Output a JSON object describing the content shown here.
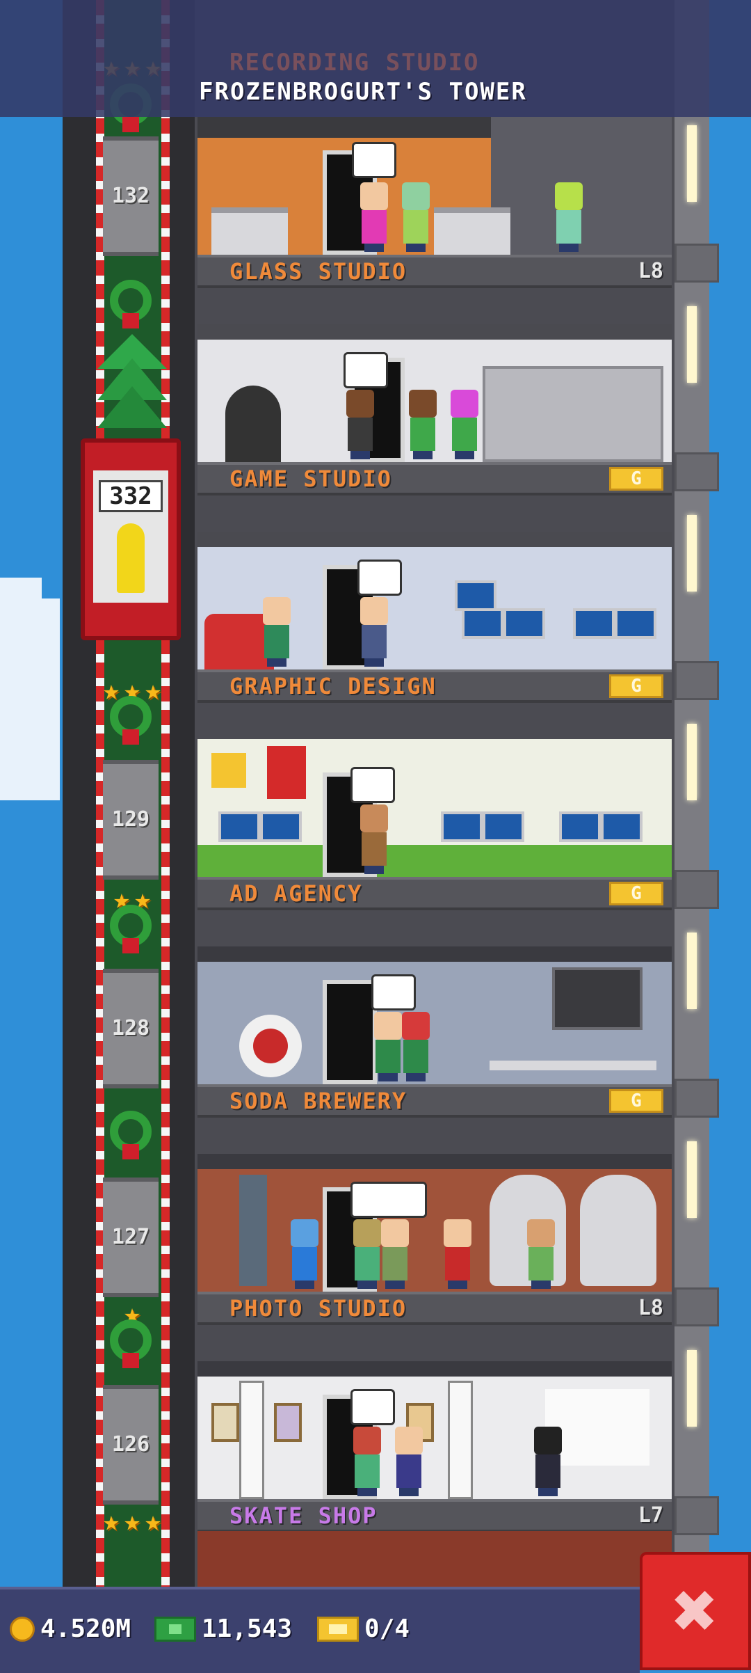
{
  "tower": {
    "title": "FROZENBROGURT'S TOWER",
    "ghost_floor_label": "RECORDING STUDIO"
  },
  "elevator": {
    "display": "332"
  },
  "shaft_floors": [
    "132",
    "129",
    "128",
    "127",
    "126"
  ],
  "floors": [
    {
      "name": "GLASS STUDIO",
      "badge_type": "level",
      "badge": "L8"
    },
    {
      "name": "GAME STUDIO",
      "badge_type": "coin",
      "badge": "G"
    },
    {
      "name": "GRAPHIC DESIGN",
      "badge_type": "coin",
      "badge": "G"
    },
    {
      "name": "AD AGENCY",
      "badge_type": "coin",
      "badge": "G"
    },
    {
      "name": "SODA BREWERY",
      "badge_type": "coin",
      "badge": "G"
    },
    {
      "name": "PHOTO STUDIO",
      "badge_type": "level",
      "badge": "L8"
    },
    {
      "name": "SKATE SHOP",
      "badge_type": "level",
      "badge": "L7"
    }
  ],
  "status_bar": {
    "coins": "4.520M",
    "bux": "11,543",
    "tickets": "0/4",
    "icons": [
      "coin-icon",
      "bux-icon",
      "ticket-icon"
    ]
  },
  "close_button": {
    "icon": "close-icon",
    "label": "✖"
  },
  "colors": {
    "label_orange": "#f08a3a",
    "label_purple": "#c87ae8",
    "header": "#343a66",
    "close_red": "#e02a2a",
    "sky": "#2f8fd8"
  }
}
